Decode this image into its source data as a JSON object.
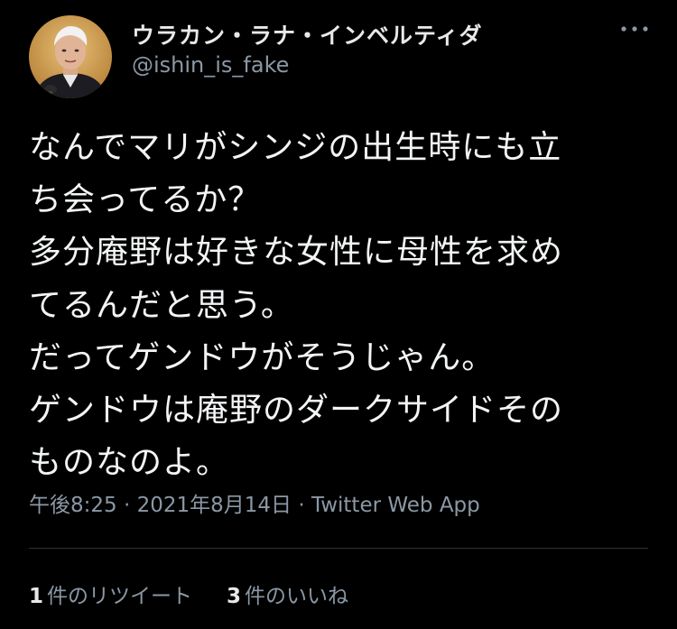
{
  "user": {
    "display_name": "ウラカン・ラナ・インベルティダ",
    "handle": "@ishin_is_fake",
    "avatar_icon": "user-avatar-photo"
  },
  "menu": {
    "icon": "more-horizontal-icon"
  },
  "tweet": {
    "lines": [
      "なんでマリがシンジの出生時にも立",
      "ち会ってるか？",
      "多分庵野は好きな女性に母性を求め",
      "てるんだと思う。",
      "だってゲンドウがそうじゃん。",
      "ゲンドウは庵野のダークサイドその",
      "ものなのよ。"
    ],
    "time": "午後8:25",
    "separator_1": " · ",
    "date": "2021年8月14日",
    "separator_2": " · ",
    "source": "Twitter Web App"
  },
  "stats": {
    "retweets_count": "1",
    "retweets_label": "件のリツイート",
    "likes_count": "3",
    "likes_label": "件のいいね"
  },
  "colors": {
    "background": "#000000",
    "primary_text": "#e7e9ea",
    "secondary_text": "#8b98a5",
    "divider": "#2f3336"
  }
}
